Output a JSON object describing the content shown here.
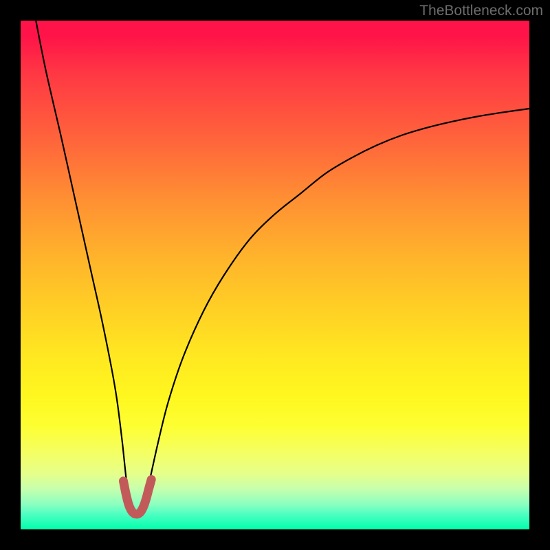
{
  "watermark": "TheBottleneck.com",
  "chart_data": {
    "type": "line",
    "title": "",
    "xlabel": "",
    "ylabel": "",
    "xlim": [
      0,
      100
    ],
    "ylim": [
      0,
      100
    ],
    "grid": false,
    "legend": false,
    "series": [
      {
        "name": "bottleneck-curve",
        "color": "#000000",
        "width": 2.2,
        "x": [
          3,
          5,
          8,
          10,
          12,
          14,
          16,
          18,
          19,
          20,
          21,
          22,
          23,
          24,
          25,
          27,
          29,
          32,
          36,
          40,
          45,
          50,
          55,
          60,
          65,
          70,
          75,
          80,
          85,
          90,
          95,
          100
        ],
        "y": [
          100,
          90,
          77,
          68,
          59,
          50,
          41,
          31,
          25,
          17,
          8,
          4,
          3,
          4,
          8,
          17,
          25,
          34,
          43,
          50,
          57,
          62,
          66,
          70,
          73,
          75.5,
          77.5,
          79,
          80.2,
          81.2,
          82,
          82.7
        ]
      },
      {
        "name": "tip-marker",
        "color": "#c25a5a",
        "width": 13,
        "linecap": "round",
        "x": [
          20.2,
          20.7,
          21.2,
          21.7,
          22.2,
          22.7,
          23.2,
          23.7,
          24.2,
          24.7,
          25.2,
          25.7
        ],
        "y": [
          9.5,
          7.0,
          5.0,
          3.8,
          3.2,
          3.0,
          3.1,
          3.6,
          4.6,
          6.1,
          8.0,
          9.8
        ]
      }
    ]
  }
}
